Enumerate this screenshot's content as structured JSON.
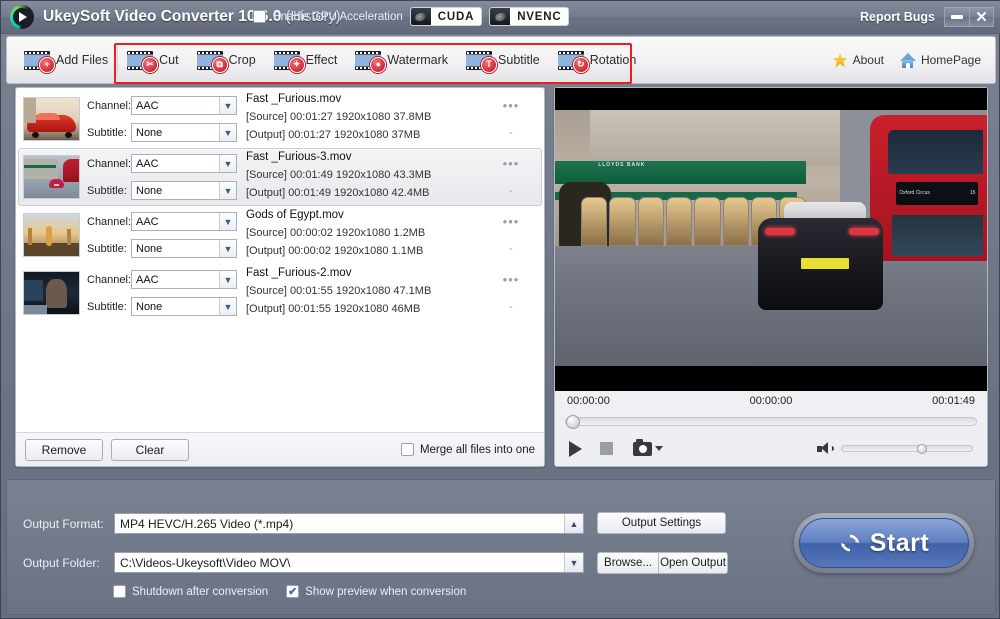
{
  "titlebar": {
    "app_name": "UkeySoft Video Converter 10.6.0",
    "suffix": "(History)",
    "report_bugs": "Report Bugs",
    "logo_icon": "play-logo-icon",
    "minimize_icon": "minimize-icon",
    "close_icon": "close-icon"
  },
  "toolbar": {
    "buttons": [
      {
        "label": "Add Files",
        "icon": "film-plus-icon",
        "glyph": "+"
      },
      {
        "label": "Cut",
        "icon": "film-scissors-icon",
        "glyph": "✂"
      },
      {
        "label": "Crop",
        "icon": "film-crop-icon",
        "glyph": "⧉"
      },
      {
        "label": "Effect",
        "icon": "film-wand-icon",
        "glyph": "✦"
      },
      {
        "label": "Watermark",
        "icon": "film-droplet-icon",
        "glyph": "●"
      },
      {
        "label": "Subtitle",
        "icon": "film-subtitle-icon",
        "glyph": "T"
      },
      {
        "label": "Rotation",
        "icon": "film-rotation-icon",
        "glyph": "↻"
      }
    ],
    "links": [
      {
        "label": "About",
        "icon": "star-icon"
      },
      {
        "label": "HomePage",
        "icon": "house-icon"
      }
    ],
    "highlight_color": "#ef1d1d"
  },
  "filelist": {
    "channel_label": "Channel:",
    "subtitle_label": "Subtitle:",
    "source_tag": "[Source]",
    "output_tag": "[Output]",
    "more_icon": "•••",
    "dash": "-",
    "rows": [
      {
        "name": "Fast _Furious.mov",
        "channel": "AAC",
        "subtitle": "None",
        "source": "[Source]  00:01:27  1920x1080  37.8MB",
        "output": "[Output]  00:01:27  1920x1080  37MB",
        "selected": false,
        "thumb": "red-sports-car"
      },
      {
        "name": "Fast _Furious-3.mov",
        "channel": "AAC",
        "subtitle": "None",
        "source": "[Source]  00:01:49  1920x1080  43.3MB",
        "output": "[Output]  00:01:49  1920x1080  42.4MB",
        "selected": true,
        "thumb": "street-with-bus"
      },
      {
        "name": "Gods of Egypt.mov",
        "channel": "AAC",
        "subtitle": "None",
        "source": "[Source]  00:00:02  1920x1080  1.2MB",
        "output": "[Output]  00:00:02  1920x1080  1.1MB",
        "selected": false,
        "thumb": "desert-scene"
      },
      {
        "name": "Fast _Furious-2.mov",
        "channel": "AAC",
        "subtitle": "None",
        "source": "[Source]  00:01:55  1920x1080  47.1MB",
        "output": "[Output]  00:01:55  1920x1080  46MB",
        "selected": false,
        "thumb": "dark-car-interior"
      }
    ],
    "remove_label": "Remove",
    "clear_label": "Clear",
    "merge_label": "Merge all files into one",
    "merge_checked": false
  },
  "preview": {
    "time_start": "00:00:00",
    "time_current": "00:00:00",
    "time_total": "00:01:49",
    "seek_position_pct": 0,
    "volume_pct": 58,
    "play_icon": "play-icon",
    "stop_icon": "stop-icon",
    "snapshot_icon": "camera-icon",
    "snapshot_menu_icon": "chevron-down-icon",
    "volume_icon": "speaker-icon"
  },
  "settings": {
    "gpu_label": "Enable GPU Acceleration",
    "gpu_checked": false,
    "gpu_badges": [
      {
        "label": "CUDA",
        "icon": "nvidia-eye-icon"
      },
      {
        "label": "NVENC",
        "icon": "nvidia-eye-icon"
      }
    ],
    "format_label": "Output Format:",
    "format_value": "MP4 HEVC/H.265 Video (*.mp4)",
    "format_arrow": "▲",
    "folder_label": "Output Folder:",
    "folder_value": "C:\\Videos-Ukeysoft\\Video MOV\\",
    "folder_arrow": "▼",
    "output_settings_label": "Output Settings",
    "browse_label": "Browse...",
    "open_output_label": "Open Output",
    "shutdown_label": "Shutdown after conversion",
    "shutdown_checked": false,
    "show_preview_label": "Show preview when conversion",
    "show_preview_checked": true,
    "check_glyph": "✔",
    "start_label": "Start",
    "start_icon": "refresh-icon",
    "accent_color": "#4a6cb3"
  }
}
